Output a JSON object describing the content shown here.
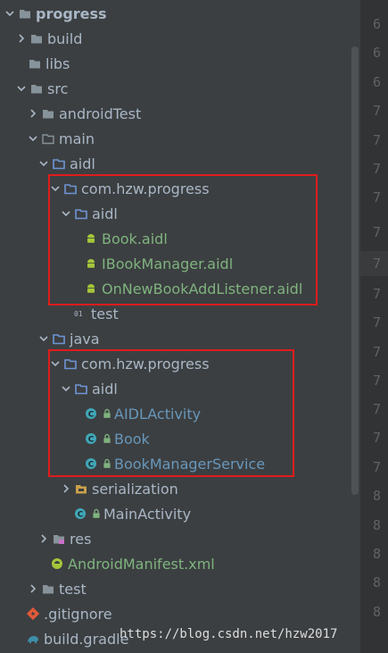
{
  "tree": {
    "root": "progress",
    "build": "build",
    "libs": "libs",
    "src": "src",
    "androidTest": "androidTest",
    "main": "main",
    "aidl_dir": "aidl",
    "aidl_pkg": "com.hzw.progress",
    "aidl_sub": "aidl",
    "file_book_aidl": "Book.aidl",
    "file_ibookmanager_aidl": "IBookManager.aidl",
    "file_listener_aidl": "OnNewBookAddListener.aidl",
    "test_file": "test",
    "java_dir": "java",
    "java_pkg": "com.hzw.progress",
    "java_sub": "aidl",
    "class_aidlactivity": "AIDLActivity",
    "class_book": "Book",
    "class_bookmanagerservice": "BookManagerService",
    "serialization": "serialization",
    "class_mainactivity": "MainActivity",
    "res": "res",
    "manifest": "AndroidManifest.xml",
    "test_dir": "test",
    "gitignore": ".gitignore",
    "build_gradle": "build.gradle"
  },
  "gutter": {
    "lines": [
      "6",
      "6",
      "6",
      "7",
      "7",
      "7",
      "7",
      "7",
      "7",
      "7",
      "7",
      "7",
      "7",
      "7",
      "7",
      "7",
      "8",
      "8",
      "8",
      "8",
      "8",
      "8",
      "8",
      "8",
      "8"
    ]
  },
  "watermark": "https://blog.csdn.net/hzw2017",
  "colors": {
    "background": "#3c3f41",
    "highlight_box": "#e01c1c",
    "folder": "#87939a",
    "package_folder": "#6e95d6",
    "android_green": "#a4c639",
    "class_circle": "#40a7b8"
  },
  "icons": {
    "folder": "folder-icon",
    "package": "package-folder-icon",
    "android": "android-file-icon",
    "class": "class-icon",
    "manifest": "android-manifest-icon",
    "git": "git-icon",
    "gradle": "gradle-icon"
  }
}
